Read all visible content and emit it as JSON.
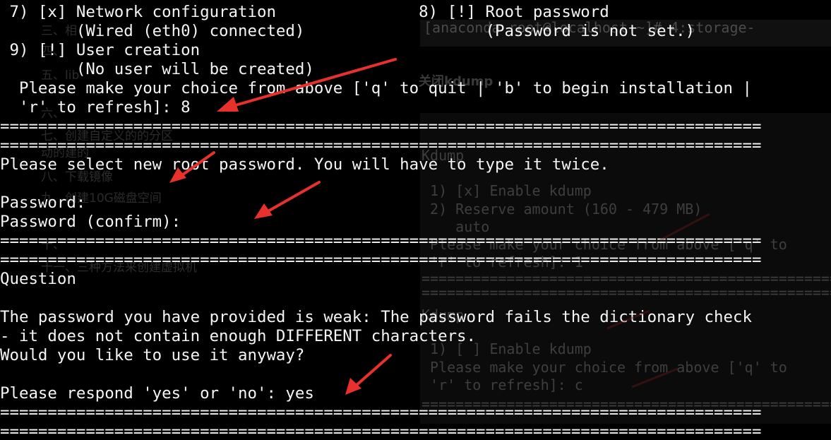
{
  "terminal": {
    "lines": [
      " 7) [x] Network configuration               8) [!] Root password",
      "        (Wired (eth0) connected)                   (Password is not set.)",
      " 9) [!] User creation",
      "        (No user will be created)",
      "  Please make your choice from above ['q' to quit | 'b' to begin installation |",
      "  'r' to refresh]: 8",
      "================================================================================",
      "================================================================================",
      "Please select new root password. You will have to type it twice.",
      "",
      "Password:",
      "Password (confirm):",
      "================================================================================",
      "================================================================================",
      "Question",
      "",
      "The password you have provided is weak: The password fails the dictionary check",
      "- it does not contain enough DIFFERENT characters.",
      "Would you like to use it anyway?",
      "",
      "Please respond 'yes' or 'no': yes",
      "================================================================================",
      "================================================================================"
    ]
  },
  "background": {
    "left_toc": [
      "三、相",
      "四、",
      "五、lib",
      "六、",
      "七、创建自定义的的分区",
      "动的建的",
      "八、下载镜像",
      "九、创建10G磁盘空间",
      "十、",
      "十一、三种方法来创建虚拟机"
    ],
    "right_heading": "关闭kdump",
    "right_prompt": "[anaconda root@localhost ~]# 4:storage-",
    "right_lines": [
      "Kdump",
      " 1) [x] Enable kdump",
      " 2) Reserve amount (160 - 479 MB)",
      "    auto",
      " Please make your choice from above ['q' to",
      " 'r' to refresh]: 1",
      "=================================================",
      "=================================================",
      "Kdump",
      " 1) [ ] Enable kdump",
      " Please make your choice from above ['q' to",
      " 'r' to refresh]: c",
      "================================================="
    ]
  },
  "colors": {
    "terminal_bg": "#000000",
    "terminal_fg": "#f5f5f5",
    "arrow": "#e8302c"
  }
}
